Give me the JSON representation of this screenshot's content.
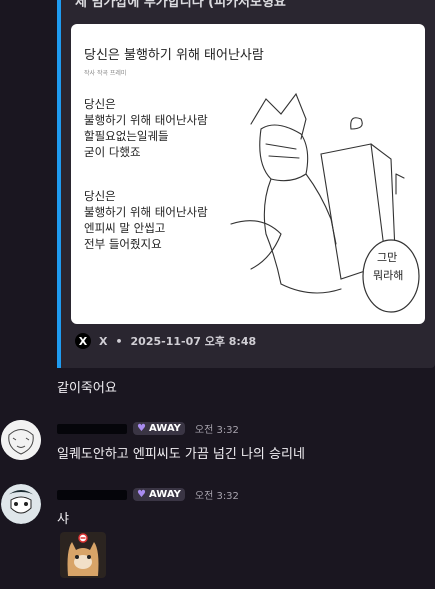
{
  "embed": {
    "title": "제 밈가깝에 투가합니다 (피카저모형요",
    "card": {
      "heading": "당신은 불행하기 위해 태어난사람",
      "subtext": "작사 작곡 프레미",
      "lines": [
        "당신은",
        "불행하기 위해 태어난사람",
        "할필요없는일궤들",
        "굳이 다했죠",
        "",
        "당신은",
        "불행하기 위해 태어난사람",
        "엔피씨 말 안씹고",
        "전부 들어줬지요"
      ],
      "bubble_line1": "그만",
      "bubble_line2": "뭐라해"
    },
    "footer": {
      "source": "X",
      "date": "2025-11-07 오후 8:48",
      "separator": "•"
    },
    "accent": "#1f9bf0"
  },
  "messages": [
    {
      "text": "같이죽어요"
    },
    {
      "badge": "AWAY",
      "time": "오전 3:32",
      "text": "일퀘도안하고 엔피씨도 가끔 넘긴 나의 승리네"
    },
    {
      "badge": "AWAY",
      "time": "오전 3:32",
      "text": "샤"
    }
  ]
}
